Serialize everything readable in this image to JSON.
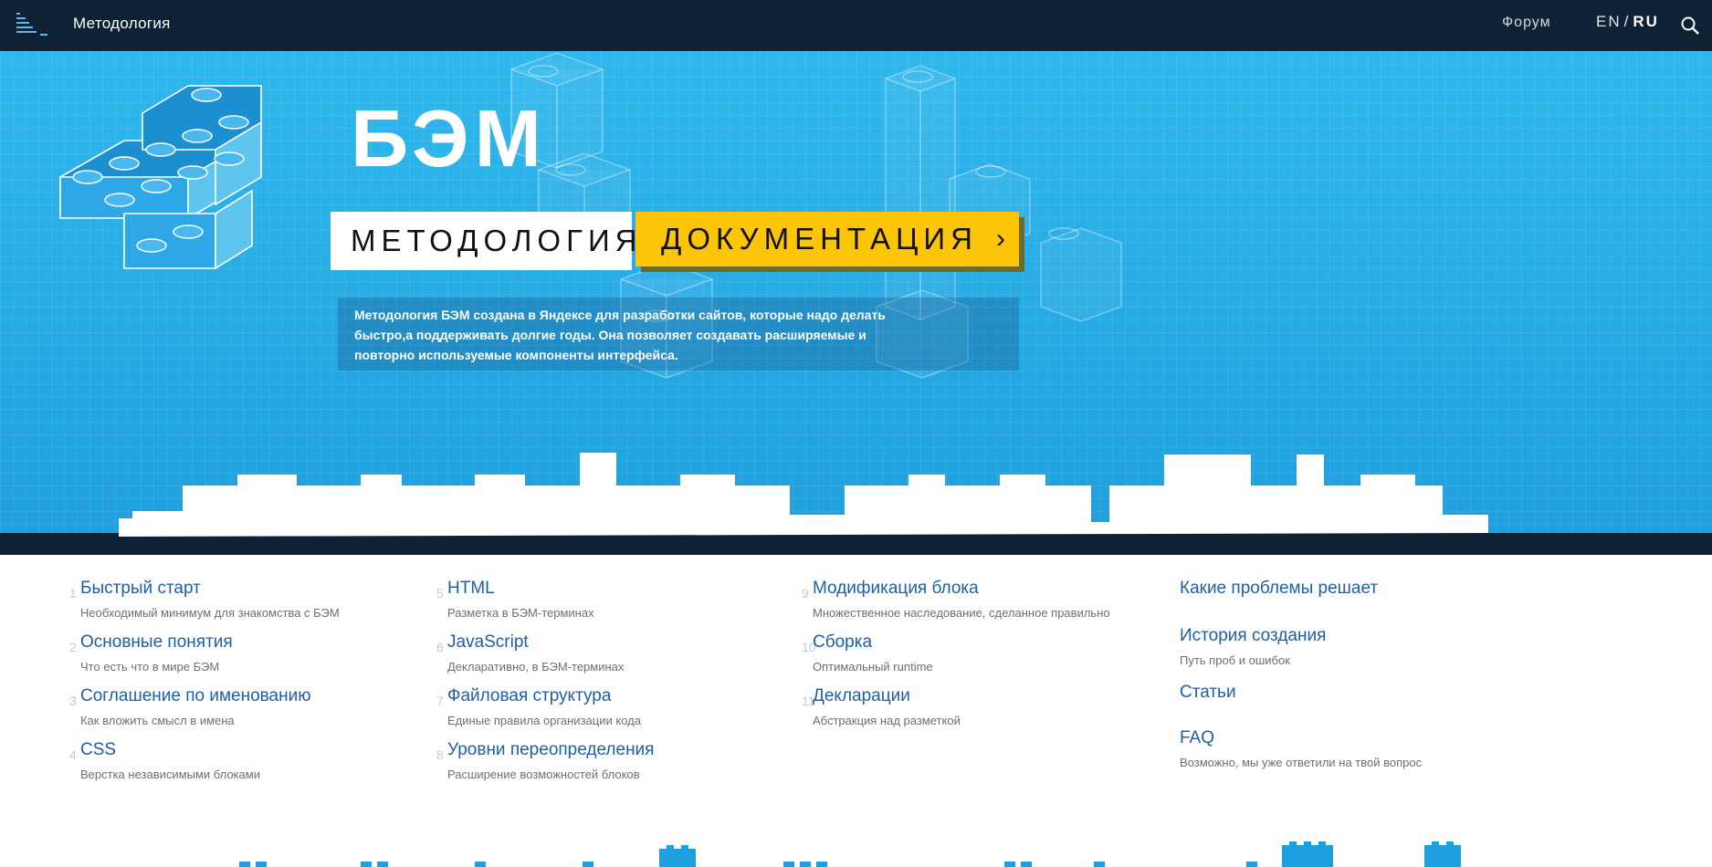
{
  "header": {
    "brand": "Методология",
    "forum": "Форум",
    "lang_en": "EN",
    "lang_sep": "/",
    "lang_ru": "RU"
  },
  "hero": {
    "title": "БЭМ",
    "methodology_button": "МЕТОДОЛОГИЯ",
    "docs_button": "ДОКУМЕНТАЦИЯ",
    "docs_chevron": "›",
    "description": "Методология БЭМ создана в Яндексе для разработки сайтов, которые надо делать быстро,а поддерживать долгие годы. Она позволяет создавать расширяемые и повторно используемые компоненты интерфейса."
  },
  "columns": [
    {
      "items": [
        {
          "num": "1",
          "title": "Быстрый старт",
          "sub": "Необходимый минимум для знакомства с БЭМ"
        },
        {
          "num": "2",
          "title": "Основные понятия",
          "sub": "Что есть что в мире БЭМ"
        },
        {
          "num": "3",
          "title": "Соглашение по именованию",
          "sub": "Как вложить смысл в имена"
        },
        {
          "num": "4",
          "title": "CSS",
          "sub": "Верстка независимыми блоками"
        }
      ]
    },
    {
      "items": [
        {
          "num": "5",
          "title": "HTML",
          "sub": "Разметка в БЭМ-терминах"
        },
        {
          "num": "6",
          "title": "JavaScript",
          "sub": "Декларативно, в БЭМ-терминах"
        },
        {
          "num": "7",
          "title": "Файловая структура",
          "sub": "Единые правила организации кода"
        },
        {
          "num": "8",
          "title": "Уровни переопределения",
          "sub": "Расширение возможностей блоков"
        }
      ]
    },
    {
      "items": [
        {
          "num": "9",
          "title": "Модификация блока",
          "sub": "Множественное наследование, сделанное правильно"
        },
        {
          "num": "10",
          "title": "Сборка",
          "sub": "Оптимальный runtime"
        },
        {
          "num": "11",
          "title": "Декларации",
          "sub": "Абстракция над разметкой"
        }
      ]
    },
    {
      "items": [
        {
          "title": "Какие проблемы решает",
          "sub": ""
        },
        {
          "title": "История создания",
          "sub": "Путь проб и ошибок"
        },
        {
          "title": "Статьи",
          "sub": ""
        },
        {
          "title": "FAQ",
          "sub": "Возможно, мы уже ответили на твой вопрос"
        }
      ]
    }
  ],
  "colors": {
    "topbar": "#0f2235",
    "hero_blue": "#2fb8ec",
    "accent_yellow": "#fcc507",
    "link_blue": "#1f5fa8"
  }
}
